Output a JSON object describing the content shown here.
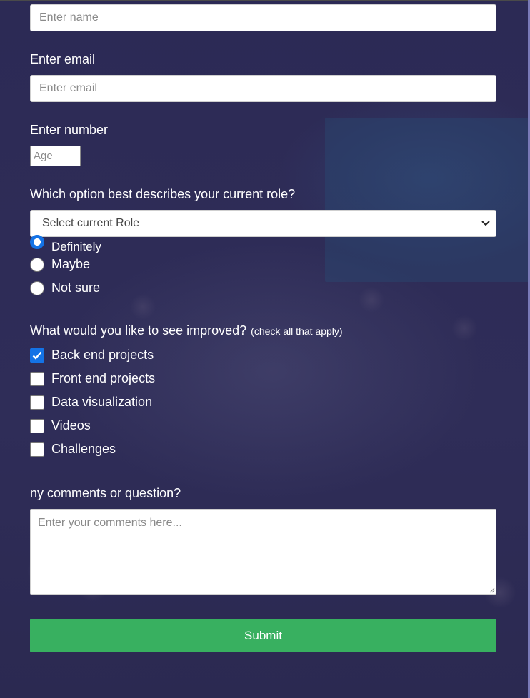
{
  "colors": {
    "background": "#2b2952",
    "submit": "#38b060",
    "accent": "#1473e6"
  },
  "name_field": {
    "placeholder": "Enter name"
  },
  "email": {
    "label": "Enter email",
    "placeholder": "Enter email"
  },
  "number": {
    "label": "Enter number",
    "placeholder": "Age"
  },
  "role": {
    "label": "Which option best describes your current role?",
    "selected": "Select current Role"
  },
  "recommend": {
    "options": [
      {
        "label": "Definitely",
        "checked": true
      },
      {
        "label": "Maybe",
        "checked": false
      },
      {
        "label": "Not sure",
        "checked": false
      }
    ]
  },
  "improve": {
    "label": "What would you like to see improved?",
    "hint": "(check all that apply)",
    "options": [
      {
        "label": "Back end projects",
        "checked": true
      },
      {
        "label": "Front end projects",
        "checked": false
      },
      {
        "label": "Data visualization",
        "checked": false
      },
      {
        "label": "Videos",
        "checked": false
      },
      {
        "label": "Challenges",
        "checked": false
      }
    ]
  },
  "comments": {
    "label": "ny comments or question?",
    "placeholder": "Enter your comments here..."
  },
  "submit": {
    "label": "Submit"
  }
}
